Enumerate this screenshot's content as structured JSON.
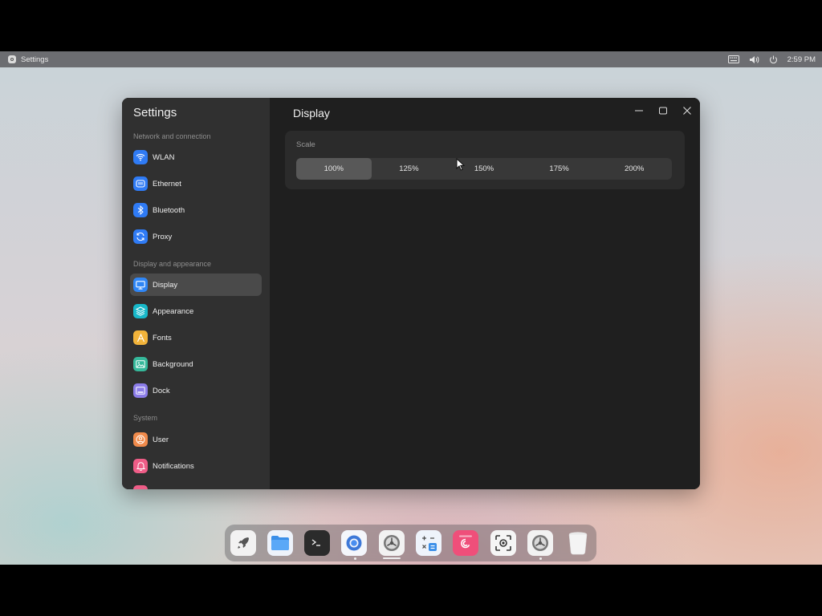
{
  "topbar": {
    "app_name": "Settings",
    "time": "2:59 PM",
    "tray_icons": [
      "keyboard-icon",
      "volume-icon",
      "power-icon"
    ]
  },
  "window": {
    "sidebar": {
      "title": "Settings",
      "sections": [
        {
          "label": "Network and connection",
          "items": [
            {
              "label": "WLAN",
              "icon": "wifi-icon",
              "color": "#2f7bf5"
            },
            {
              "label": "Ethernet",
              "icon": "ethernet-icon",
              "color": "#2f7bf5"
            },
            {
              "label": "Bluetooth",
              "icon": "bluetooth-icon",
              "color": "#2f7bf5"
            },
            {
              "label": "Proxy",
              "icon": "proxy-icon",
              "color": "#2f7bf5"
            }
          ]
        },
        {
          "label": "Display and appearance",
          "items": [
            {
              "label": "Display",
              "icon": "monitor-icon",
              "color": "#2f86f6",
              "active": true
            },
            {
              "label": "Appearance",
              "icon": "layers-icon",
              "color": "#17b8c9"
            },
            {
              "label": "Fonts",
              "icon": "font-icon",
              "color": "#f2b33a"
            },
            {
              "label": "Background",
              "icon": "image-icon",
              "color": "#35b89a"
            },
            {
              "label": "Dock",
              "icon": "dock-icon",
              "color": "#8b7ce8"
            }
          ]
        },
        {
          "label": "System",
          "items": [
            {
              "label": "User",
              "icon": "user-icon",
              "color": "#f08a4b"
            },
            {
              "label": "Notifications",
              "icon": "bell-icon",
              "color": "#ef5d87"
            }
          ]
        }
      ]
    },
    "content": {
      "title": "Display",
      "scale": {
        "label": "Scale",
        "options": [
          "100%",
          "125%",
          "150%",
          "175%",
          "200%"
        ],
        "selected": "100%"
      }
    }
  },
  "dock": {
    "apps": [
      {
        "name": "launcher-icon"
      },
      {
        "name": "files-icon"
      },
      {
        "name": "terminal-icon"
      },
      {
        "name": "browser-icon"
      },
      {
        "name": "settings-icon"
      },
      {
        "name": "calculator-icon"
      },
      {
        "name": "debian-icon"
      },
      {
        "name": "screenshot-icon"
      },
      {
        "name": "settings-alt-icon"
      },
      {
        "name": "trash-icon"
      }
    ]
  }
}
